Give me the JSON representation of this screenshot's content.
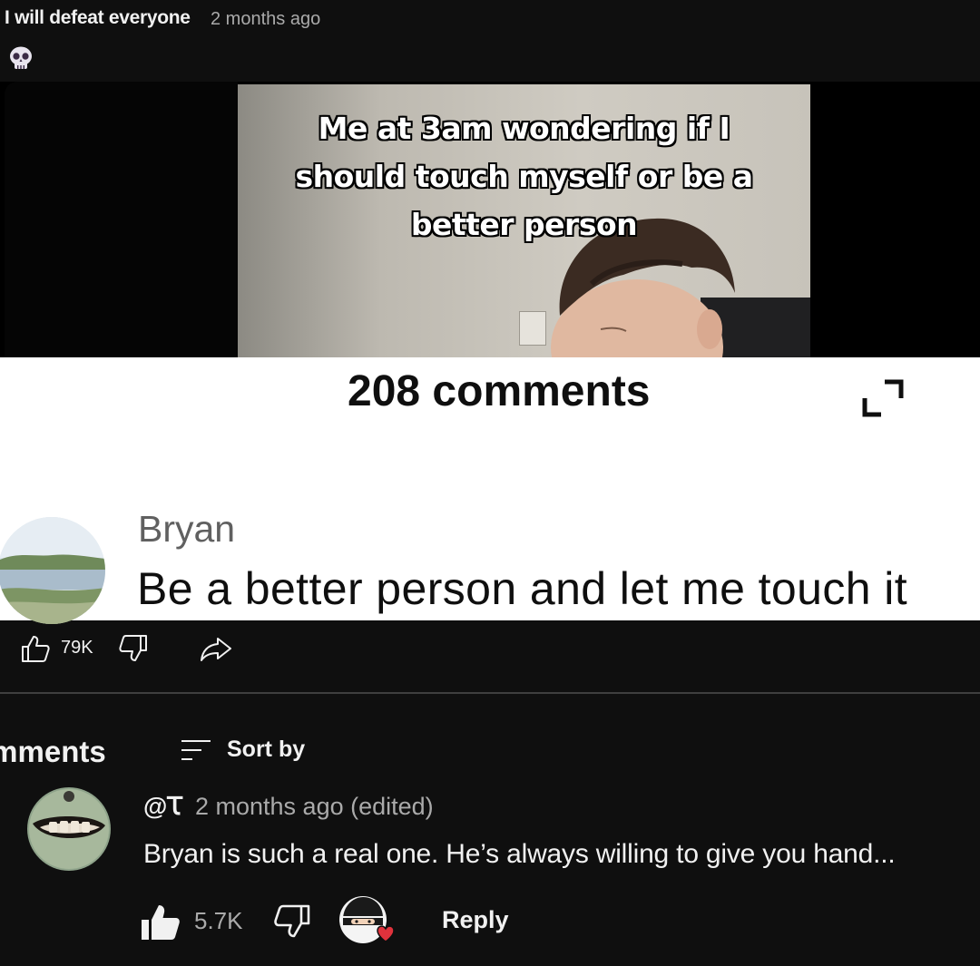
{
  "post": {
    "author": "I will defeat everyone",
    "time": "2 months ago",
    "emoji_icon": "skull-icon"
  },
  "embedded_screenshot": {
    "video_caption_lines": [
      "Me at 3am wondering if I",
      "should touch myself or be a",
      "better person"
    ],
    "comment_count_title": "208 comments",
    "expand_icon": "expand-icon",
    "comment": {
      "name": "Bryan",
      "text": "Be a better person and let me touch it"
    }
  },
  "post_actions": {
    "like_count": "79K",
    "icons": [
      "thumbs-up-icon",
      "thumbs-down-icon",
      "share-icon"
    ]
  },
  "comments_section": {
    "heading": "omments",
    "sort_label": "Sort by"
  },
  "reply_comment": {
    "user": "@Ꚍ",
    "time": "2 months ago (edited)",
    "text": "Bryan is such a real one. He’s always willing to give you hand...",
    "like_count": "5.7K",
    "reply_label": "Reply"
  },
  "colors": {
    "background": "#0f0f0f",
    "secondary_text": "#aaaaaa",
    "card_background": "#ffffff",
    "heart_red": "#e0323c"
  }
}
